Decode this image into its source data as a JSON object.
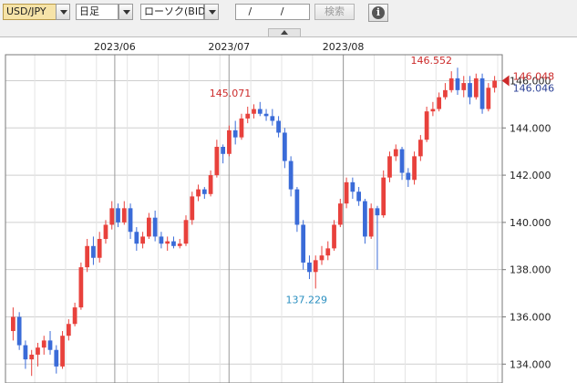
{
  "toolbar": {
    "pair": "USD/JPY",
    "timeframe": "日足",
    "chart_type": "ローソク(BID)",
    "date_placeholder": "/ /",
    "search_label": "検索",
    "info_icon": "info-icon"
  },
  "colors": {
    "up": "#e8413c",
    "down": "#3a6bd8",
    "grid": "#cfcfcf",
    "bid": "#cc2a2a",
    "ask": "#2a3f96",
    "low_label": "#2a8fc0"
  },
  "chart_data": {
    "type": "candlestick",
    "title": "",
    "symbol": "USD/JPY",
    "timeframe": "daily",
    "month_labels": [
      "2023/06",
      "2023/07",
      "2023/08"
    ],
    "y_ticks": [
      "134.000",
      "136.000",
      "138.000",
      "140.000",
      "142.000",
      "144.000",
      "146.000"
    ],
    "ylim": [
      133.2,
      147.1
    ],
    "grid": true,
    "current_bid": "146.048",
    "current_ask": "146.046",
    "annotations": [
      {
        "label": "145.071",
        "type": "high"
      },
      {
        "label": "137.229",
        "type": "low"
      },
      {
        "label": "146.552",
        "type": "high"
      }
    ],
    "candles": [
      [
        135.4,
        136.4,
        135.0,
        136.0
      ],
      [
        136.0,
        136.2,
        134.6,
        134.8
      ],
      [
        134.8,
        135.0,
        133.8,
        134.2
      ],
      [
        134.2,
        134.6,
        133.5,
        134.4
      ],
      [
        134.4,
        134.9,
        133.9,
        134.7
      ],
      [
        134.7,
        135.2,
        134.4,
        135.0
      ],
      [
        135.0,
        135.4,
        134.4,
        134.6
      ],
      [
        134.6,
        134.8,
        133.6,
        133.9
      ],
      [
        133.9,
        135.4,
        133.8,
        135.2
      ],
      [
        135.2,
        135.9,
        135.0,
        135.7
      ],
      [
        135.7,
        136.6,
        135.6,
        136.4
      ],
      [
        136.4,
        138.3,
        136.3,
        138.1
      ],
      [
        138.1,
        139.3,
        137.9,
        139.0
      ],
      [
        139.0,
        139.4,
        138.2,
        138.5
      ],
      [
        138.5,
        139.6,
        138.3,
        139.3
      ],
      [
        139.3,
        140.1,
        139.1,
        139.9
      ],
      [
        139.9,
        140.9,
        139.7,
        140.6
      ],
      [
        140.6,
        140.8,
        139.8,
        140.0
      ],
      [
        140.0,
        140.9,
        139.9,
        140.6
      ],
      [
        140.6,
        140.8,
        139.3,
        139.6
      ],
      [
        139.6,
        139.8,
        138.8,
        139.1
      ],
      [
        139.1,
        139.6,
        138.9,
        139.4
      ],
      [
        139.4,
        140.4,
        139.3,
        140.2
      ],
      [
        140.2,
        140.5,
        139.2,
        139.4
      ],
      [
        139.4,
        139.6,
        138.9,
        139.1
      ],
      [
        139.1,
        139.4,
        138.8,
        139.2
      ],
      [
        139.2,
        139.4,
        138.9,
        139.0
      ],
      [
        139.0,
        139.3,
        138.9,
        139.1
      ],
      [
        139.1,
        140.3,
        139.0,
        140.1
      ],
      [
        140.1,
        141.3,
        139.9,
        141.1
      ],
      [
        141.1,
        141.6,
        140.9,
        141.4
      ],
      [
        141.4,
        141.5,
        141.0,
        141.2
      ],
      [
        141.2,
        142.2,
        141.1,
        142.0
      ],
      [
        142.0,
        143.5,
        141.9,
        143.2
      ],
      [
        143.2,
        143.3,
        142.5,
        142.9
      ],
      [
        142.9,
        144.1,
        142.8,
        143.9
      ],
      [
        143.9,
        144.3,
        143.3,
        143.6
      ],
      [
        143.6,
        144.6,
        143.5,
        144.4
      ],
      [
        144.4,
        144.9,
        144.2,
        144.6
      ],
      [
        144.6,
        145.0,
        144.4,
        144.8
      ],
      [
        144.8,
        145.1,
        144.5,
        144.6
      ],
      [
        144.6,
        144.8,
        144.3,
        144.5
      ],
      [
        144.5,
        144.8,
        144.1,
        144.3
      ],
      [
        144.3,
        144.5,
        143.6,
        143.8
      ],
      [
        143.8,
        144.0,
        142.3,
        142.6
      ],
      [
        142.6,
        142.8,
        141.1,
        141.4
      ],
      [
        141.4,
        141.5,
        139.6,
        139.9
      ],
      [
        139.9,
        140.1,
        138.0,
        138.3
      ],
      [
        138.3,
        138.6,
        137.6,
        137.9
      ],
      [
        137.9,
        138.6,
        137.2,
        138.4
      ],
      [
        138.4,
        139.0,
        138.2,
        138.6
      ],
      [
        138.6,
        139.2,
        138.4,
        138.9
      ],
      [
        138.9,
        140.1,
        138.8,
        139.9
      ],
      [
        139.9,
        141.0,
        139.8,
        140.8
      ],
      [
        140.8,
        141.9,
        140.6,
        141.7
      ],
      [
        141.7,
        141.9,
        141.0,
        141.3
      ],
      [
        141.3,
        141.5,
        140.7,
        140.9
      ],
      [
        140.9,
        141.0,
        139.1,
        139.4
      ],
      [
        139.4,
        140.8,
        139.3,
        140.6
      ],
      [
        140.6,
        140.7,
        138.0,
        140.3
      ],
      [
        140.3,
        142.2,
        140.2,
        141.9
      ],
      [
        141.9,
        143.0,
        141.7,
        142.8
      ],
      [
        142.8,
        143.3,
        142.6,
        143.1
      ],
      [
        143.1,
        143.2,
        141.8,
        142.1
      ],
      [
        142.1,
        142.3,
        141.5,
        141.8
      ],
      [
        141.8,
        143.0,
        141.6,
        142.8
      ],
      [
        142.8,
        143.7,
        142.6,
        143.5
      ],
      [
        143.5,
        144.9,
        143.4,
        144.7
      ],
      [
        144.7,
        145.1,
        144.5,
        144.8
      ],
      [
        144.8,
        145.5,
        144.7,
        145.3
      ],
      [
        145.3,
        145.9,
        145.2,
        145.6
      ],
      [
        145.6,
        146.4,
        145.5,
        146.1
      ],
      [
        146.1,
        146.55,
        145.4,
        145.6
      ],
      [
        145.6,
        146.2,
        145.3,
        145.9
      ],
      [
        145.9,
        146.2,
        145.0,
        145.3
      ],
      [
        145.3,
        146.3,
        145.2,
        146.1
      ],
      [
        146.1,
        146.3,
        144.6,
        144.8
      ],
      [
        144.8,
        145.9,
        144.7,
        145.7
      ],
      [
        145.7,
        146.2,
        145.5,
        146.0
      ]
    ]
  }
}
